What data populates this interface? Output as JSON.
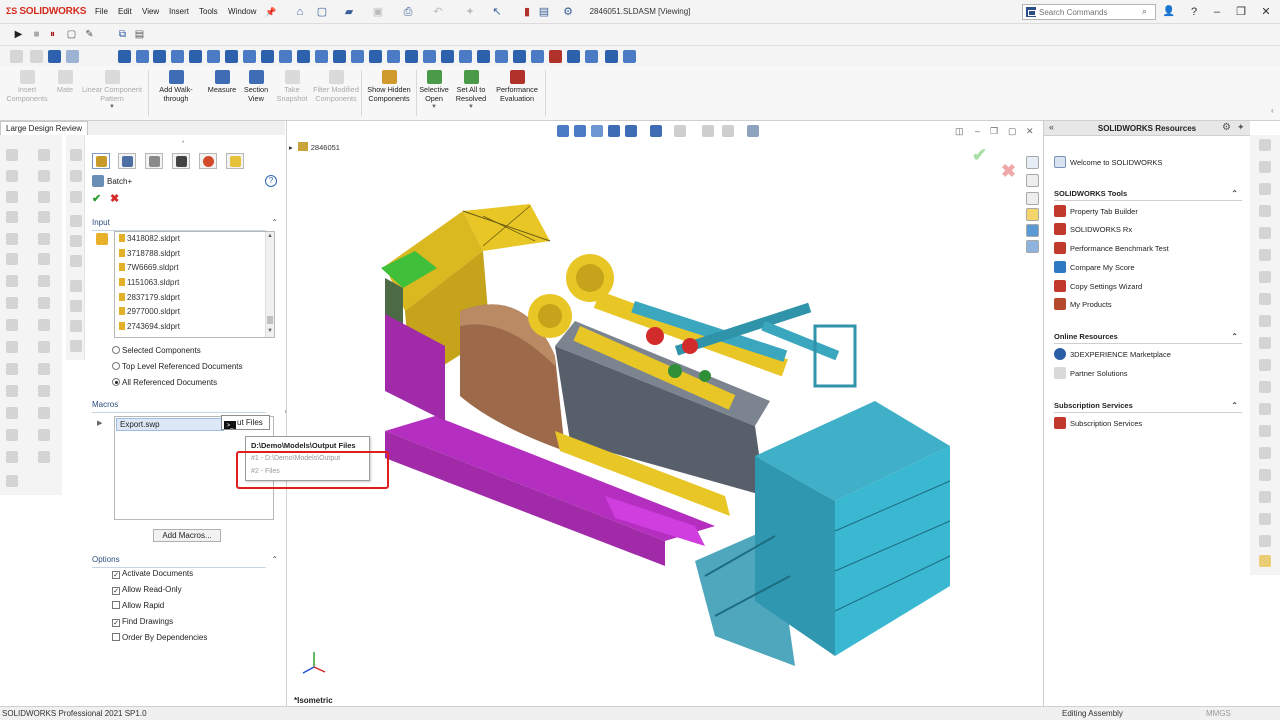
{
  "app": {
    "logo_text": "SOLIDWORKS",
    "document_title": "2846051.SLDASM [Viewing]",
    "menu": [
      "File",
      "Edit",
      "View",
      "Insert",
      "Tools",
      "Window"
    ],
    "search_placeholder": "Search Commands",
    "colors": {
      "brand_red": "#d52b1e",
      "accent_blue": "#2e4f7e",
      "highlight_red": "#e01e1e"
    }
  },
  "ribbon": {
    "buttons": [
      {
        "label": "Insert Components",
        "enabled": false,
        "icon": "insert-components-icon"
      },
      {
        "label": "Mate",
        "enabled": false,
        "icon": "mate-icon"
      },
      {
        "label": "Linear Component Pattern",
        "enabled": false,
        "icon": "linear-pattern-icon"
      },
      {
        "label": "Add Walk-through",
        "enabled": true,
        "icon": "walk-through-icon"
      },
      {
        "label": "Measure",
        "enabled": true,
        "icon": "measure-icon"
      },
      {
        "label": "Section View",
        "enabled": true,
        "icon": "section-view-icon"
      },
      {
        "label": "Take Snapshot",
        "enabled": false,
        "icon": "snapshot-icon"
      },
      {
        "label": "Filter Modified Components",
        "enabled": false,
        "icon": "filter-icon"
      },
      {
        "label": "Show Hidden Components",
        "enabled": true,
        "icon": "show-hidden-icon"
      },
      {
        "label": "Selective Open",
        "enabled": true,
        "icon": "selective-open-icon"
      },
      {
        "label": "Set All to Resolved",
        "enabled": true,
        "icon": "resolve-icon"
      },
      {
        "label": "Performance Evaluation",
        "enabled": true,
        "icon": "performance-icon"
      }
    ]
  },
  "tab": {
    "label": "Large Design Review"
  },
  "property_manager": {
    "title": "Batch+",
    "input": {
      "header": "Input",
      "files": [
        "3418082.sldprt",
        "3718788.sldprt",
        "7W6669.sldprt",
        "1151063.sldprt",
        "2837179.sldprt",
        "2977000.sldprt",
        "2743694.sldprt"
      ],
      "options": [
        {
          "label": "Selected Components",
          "selected": false
        },
        {
          "label": "Top Level Referenced Documents",
          "selected": false
        },
        {
          "label": "All Referenced Documents",
          "selected": true
        }
      ]
    },
    "macros": {
      "header": "Macros",
      "items": [
        {
          "name": "Export.swp",
          "argument": "ut Files"
        }
      ],
      "add_button": "Add Macros..."
    },
    "options": {
      "header": "Options",
      "items": [
        {
          "label": "Activate Documents",
          "checked": true
        },
        {
          "label": "Allow Read-Only",
          "checked": true
        },
        {
          "label": "Allow Rapid",
          "checked": false
        },
        {
          "label": "Find Drawings",
          "checked": true
        },
        {
          "label": "Order By Dependencies",
          "checked": false
        }
      ]
    },
    "autocomplete": {
      "header": "D:\\Demo\\Models\\Output Files",
      "options": [
        "#1 - D:\\Demo\\Models\\Output",
        "#2 - Files"
      ]
    }
  },
  "viewport": {
    "tree_root": "2846051",
    "view_orientation": "*Isometric"
  },
  "task_pane": {
    "title": "SOLIDWORKS Resources",
    "welcome": "Welcome to SOLIDWORKS",
    "sections": [
      {
        "title": "SOLIDWORKS Tools",
        "items": [
          "Property Tab Builder",
          "SOLIDWORKS Rx",
          "Performance Benchmark Test",
          "Compare My Score",
          "Copy Settings Wizard",
          "My Products"
        ]
      },
      {
        "title": "Online Resources",
        "items": [
          "3DEXPERIENCE Marketplace",
          "Partner Solutions"
        ]
      },
      {
        "title": "Subscription Services",
        "items": [
          "Subscription Services"
        ]
      }
    ]
  },
  "status": {
    "left": "SOLIDWORKS Professional 2021 SP1.0",
    "mode": "Editing Assembly",
    "units": "MMGS"
  }
}
